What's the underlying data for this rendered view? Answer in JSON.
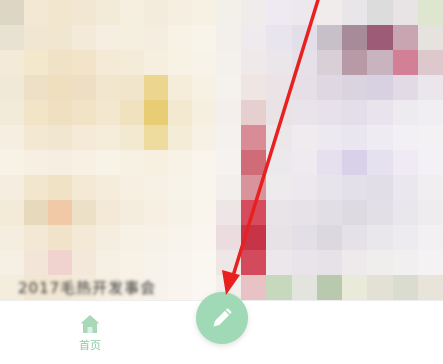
{
  "content": {
    "card_title": "2017毛热开发事会",
    "left_tiles": [
      "#ddd6c4",
      "#f3e8d4",
      "#f2e6ce",
      "#f1e7d3",
      "#f4ead8",
      "#f6efdf",
      "#f3ecdc",
      "#f6efe1",
      "#f7f1e3",
      "#e8e2d2",
      "#f0e6d2",
      "#f1e6cf",
      "#f4eada",
      "#f6eee0",
      "#f5efe0",
      "#f4ede0",
      "#f7f1e6",
      "#f9f4e9",
      "#f3ead7",
      "#f3e7cc",
      "#f0e2c7",
      "#f2e4c9",
      "#f5ead5",
      "#f4ecd9",
      "#f6eedf",
      "#f8f2e5",
      "#f8f3e8",
      "#f0e9d8",
      "#ede0c6",
      "#efdfbf",
      "#eedec3",
      "#f2e6ce",
      "#f1e5cb",
      "#ecd58f",
      "#f5edda",
      "#f7f1e4",
      "#f3ebd9",
      "#f1e4c7",
      "#efe0c1",
      "#f0e3c6",
      "#f3e7cf",
      "#f1e2bf",
      "#e8cd74",
      "#f3e9d0",
      "#f6efe0",
      "#f6efe1",
      "#f3e8d2",
      "#f1e6cf",
      "#f4ead7",
      "#f5ecd9",
      "#f3e8d0",
      "#eedc9f",
      "#f4ecd7",
      "#f7f1e5",
      "#f8f2e6",
      "#f7f0e2",
      "#f6eee0",
      "#f7f0e3",
      "#f8f3e7",
      "#f7f1e4",
      "#f7f0e1",
      "#f8f2e6",
      "#f9f5ec",
      "#f5eee0",
      "#f2e6cf",
      "#f0e2c5",
      "#f4e9d4",
      "#f5ecdb",
      "#f6efe2",
      "#f7f1e5",
      "#f8f3e9",
      "#f9f5ed",
      "#f3ead8",
      "#e7d9bb",
      "#f2c9a6",
      "#ece1c7",
      "#f3e9d6",
      "#f4ecdc",
      "#f6efe2",
      "#f7f2e7",
      "#f9f5ec",
      "#f5eee0",
      "#f2e8d3",
      "#f0e3ca",
      "#f3e9d6",
      "#f5eddf",
      "#f6f0e5",
      "#f7f2e8",
      "#f8f4eb",
      "#faf6ef",
      "#f6efe3",
      "#f3e6d8",
      "#f0d3cf",
      "#f3e8da",
      "#f6efe3",
      "#f7f1e6",
      "#f8f3ea",
      "#f9f5ee",
      "#faf7f1",
      "#f4ecdc",
      "#f1e6d2",
      "#f2e7d4",
      "#f4ebdb",
      "#f6efe2",
      "#f7f1e6",
      "#f8f3ea",
      "#f9f5ee",
      "#faf7f2"
    ],
    "right_tiles": [
      "#f3f0ea",
      "#f1ecec",
      "#efe9f1",
      "#ede8ee",
      "#f0ecec",
      "#e9e6ea",
      "#dcdcdc",
      "#e8e4e5",
      "#dfe6cf",
      "#f3f0ec",
      "#efeaee",
      "#e9e5ee",
      "#e3dfe8",
      "#c8c0c8",
      "#a88b99",
      "#9d5b78",
      "#c9a5b2",
      "#e6e2dd",
      "#f4f1ed",
      "#efeae9",
      "#ebe6ea",
      "#e6e1e8",
      "#d8d0d6",
      "#b79aa5",
      "#c9b3be",
      "#d37f95",
      "#ddc8cd",
      "#f5f2ee",
      "#efe6e4",
      "#ebe3e6",
      "#e6dfe6",
      "#dfd8e2",
      "#dad3e0",
      "#d8d1e1",
      "#e2dbe5",
      "#eae6ec",
      "#f4efed",
      "#e6cfcf",
      "#eae3e6",
      "#e9e4ea",
      "#e6e1ea",
      "#e3deea",
      "#e8e3ed",
      "#eeebf0",
      "#f0eef2",
      "#f5f1ee",
      "#d98b96",
      "#ece8ea",
      "#efebef",
      "#ede9f0",
      "#eae6f0",
      "#efebf3",
      "#f2f0f4",
      "#f3f1f4",
      "#f5f2f0",
      "#cf6c78",
      "#ece9ec",
      "#eeeaf0",
      "#e6dfee",
      "#d9d0ea",
      "#e6e1ef",
      "#efeaf3",
      "#f3f1f5",
      "#f3efed",
      "#d9949b",
      "#eeebed",
      "#ece8ee",
      "#e8e4ec",
      "#e4e0ea",
      "#e2dee8",
      "#ebe7ee",
      "#f1eef2",
      "#eee5e7",
      "#d64b5d",
      "#e8e4e8",
      "#e6e2e8",
      "#e2dee6",
      "#dedae2",
      "#e2dfe6",
      "#e9e6ec",
      "#efecf0",
      "#eadcdf",
      "#c73448",
      "#e6e2e6",
      "#e3dfe6",
      "#dcd8e0",
      "#e5e1e8",
      "#e9e6ec",
      "#eeebf0",
      "#f2f0f3",
      "#efe6e6",
      "#d24a5c",
      "#ebe7ea",
      "#e8e4ea",
      "#e6e2e8",
      "#eeeaec",
      "#f0eded",
      "#f2eff0",
      "#f4f2f2",
      "#f3efed",
      "#e9c2c5",
      "#c7d9bc",
      "#e4e4df",
      "#b8c9ad",
      "#e9ead9",
      "#e3e1d4",
      "#d9dccf",
      "#e8e4da"
    ]
  },
  "tabbar": {
    "home_label": "首页"
  },
  "colors": {
    "accent_green": "#8cc9a3",
    "fab_green": "#9fd9b5",
    "annotation_red": "#e8201f"
  },
  "icons": {
    "home": "home-icon",
    "compose": "pencil-icon",
    "annotation": "red-arrow"
  }
}
